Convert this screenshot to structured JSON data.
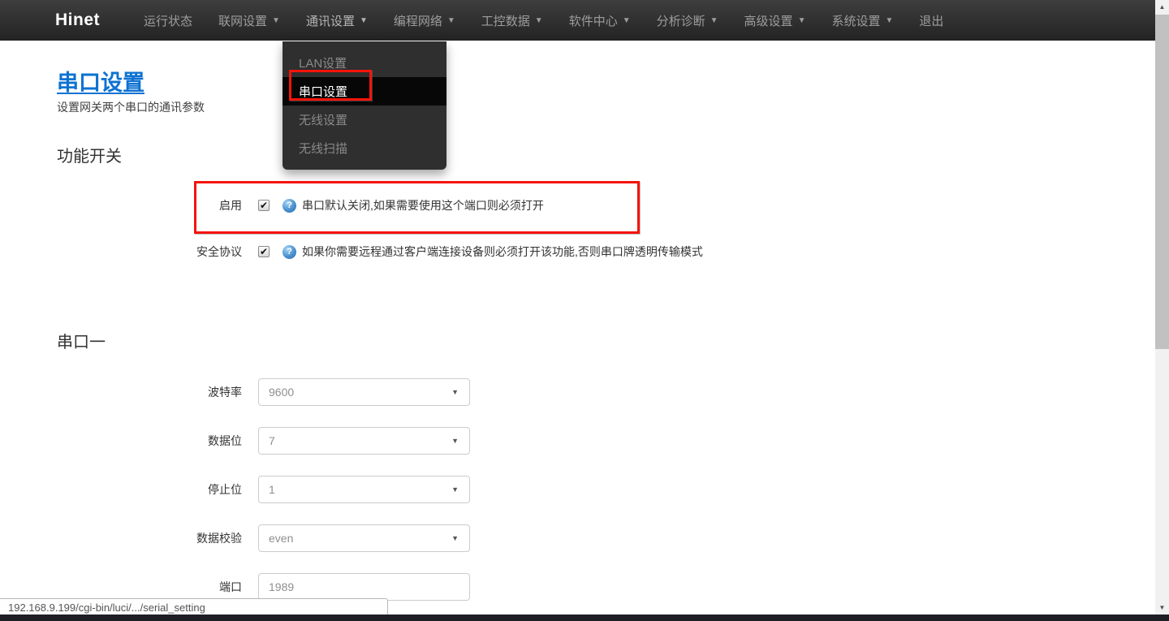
{
  "icons": {
    "caret_down": "▼",
    "select_arrow": "▼",
    "check": "✔",
    "help": "?",
    "scroll_up": "▲",
    "scroll_down": "▼"
  },
  "colors": {
    "accent_blue": "#0d72d2",
    "annotation_red": "#f5140a",
    "navbar_dark": "#2a2a2a",
    "dropdown_active_bg": "#070707",
    "help_icon_blue": "#4a90cf"
  },
  "navbar": {
    "brand": "Hinet",
    "items": [
      {
        "label": "运行状态"
      },
      {
        "label": "联网设置"
      },
      {
        "label": "通讯设置"
      },
      {
        "label": "编程网络"
      },
      {
        "label": "工控数据"
      },
      {
        "label": "软件中心"
      },
      {
        "label": "分析诊断"
      },
      {
        "label": "高级设置"
      },
      {
        "label": "系统设置"
      },
      {
        "label": "退出"
      }
    ]
  },
  "dropdown": {
    "items": [
      {
        "label": "LAN设置"
      },
      {
        "label": "串口设置",
        "active": true
      },
      {
        "label": "无线设置"
      },
      {
        "label": "无线扫描"
      }
    ]
  },
  "page": {
    "title": "串口设置",
    "subtitle": "设置网关两个串口的通讯参数",
    "switches_heading": "功能开关",
    "serial1_heading": "串口一",
    "switch_rows": [
      {
        "label": "启用",
        "checked": true,
        "help": "串口默认关闭,如果需要使用这个端口则必须打开"
      },
      {
        "label": "安全协议",
        "checked": true,
        "help": "如果你需要远程通过客户端连接设备则必须打开该功能,否则串口牌透明传输模式"
      }
    ],
    "form_rows": [
      {
        "label": "波特率",
        "value": "9600",
        "type": "select"
      },
      {
        "label": "数据位",
        "value": "7",
        "type": "select"
      },
      {
        "label": "停止位",
        "value": "1",
        "type": "select"
      },
      {
        "label": "数据校验",
        "value": "even",
        "type": "select"
      },
      {
        "label": "端口",
        "value": "1989",
        "type": "input"
      }
    ]
  },
  "status_bar": {
    "url": "192.168.9.199/cgi-bin/luci/.../serial_setting"
  }
}
